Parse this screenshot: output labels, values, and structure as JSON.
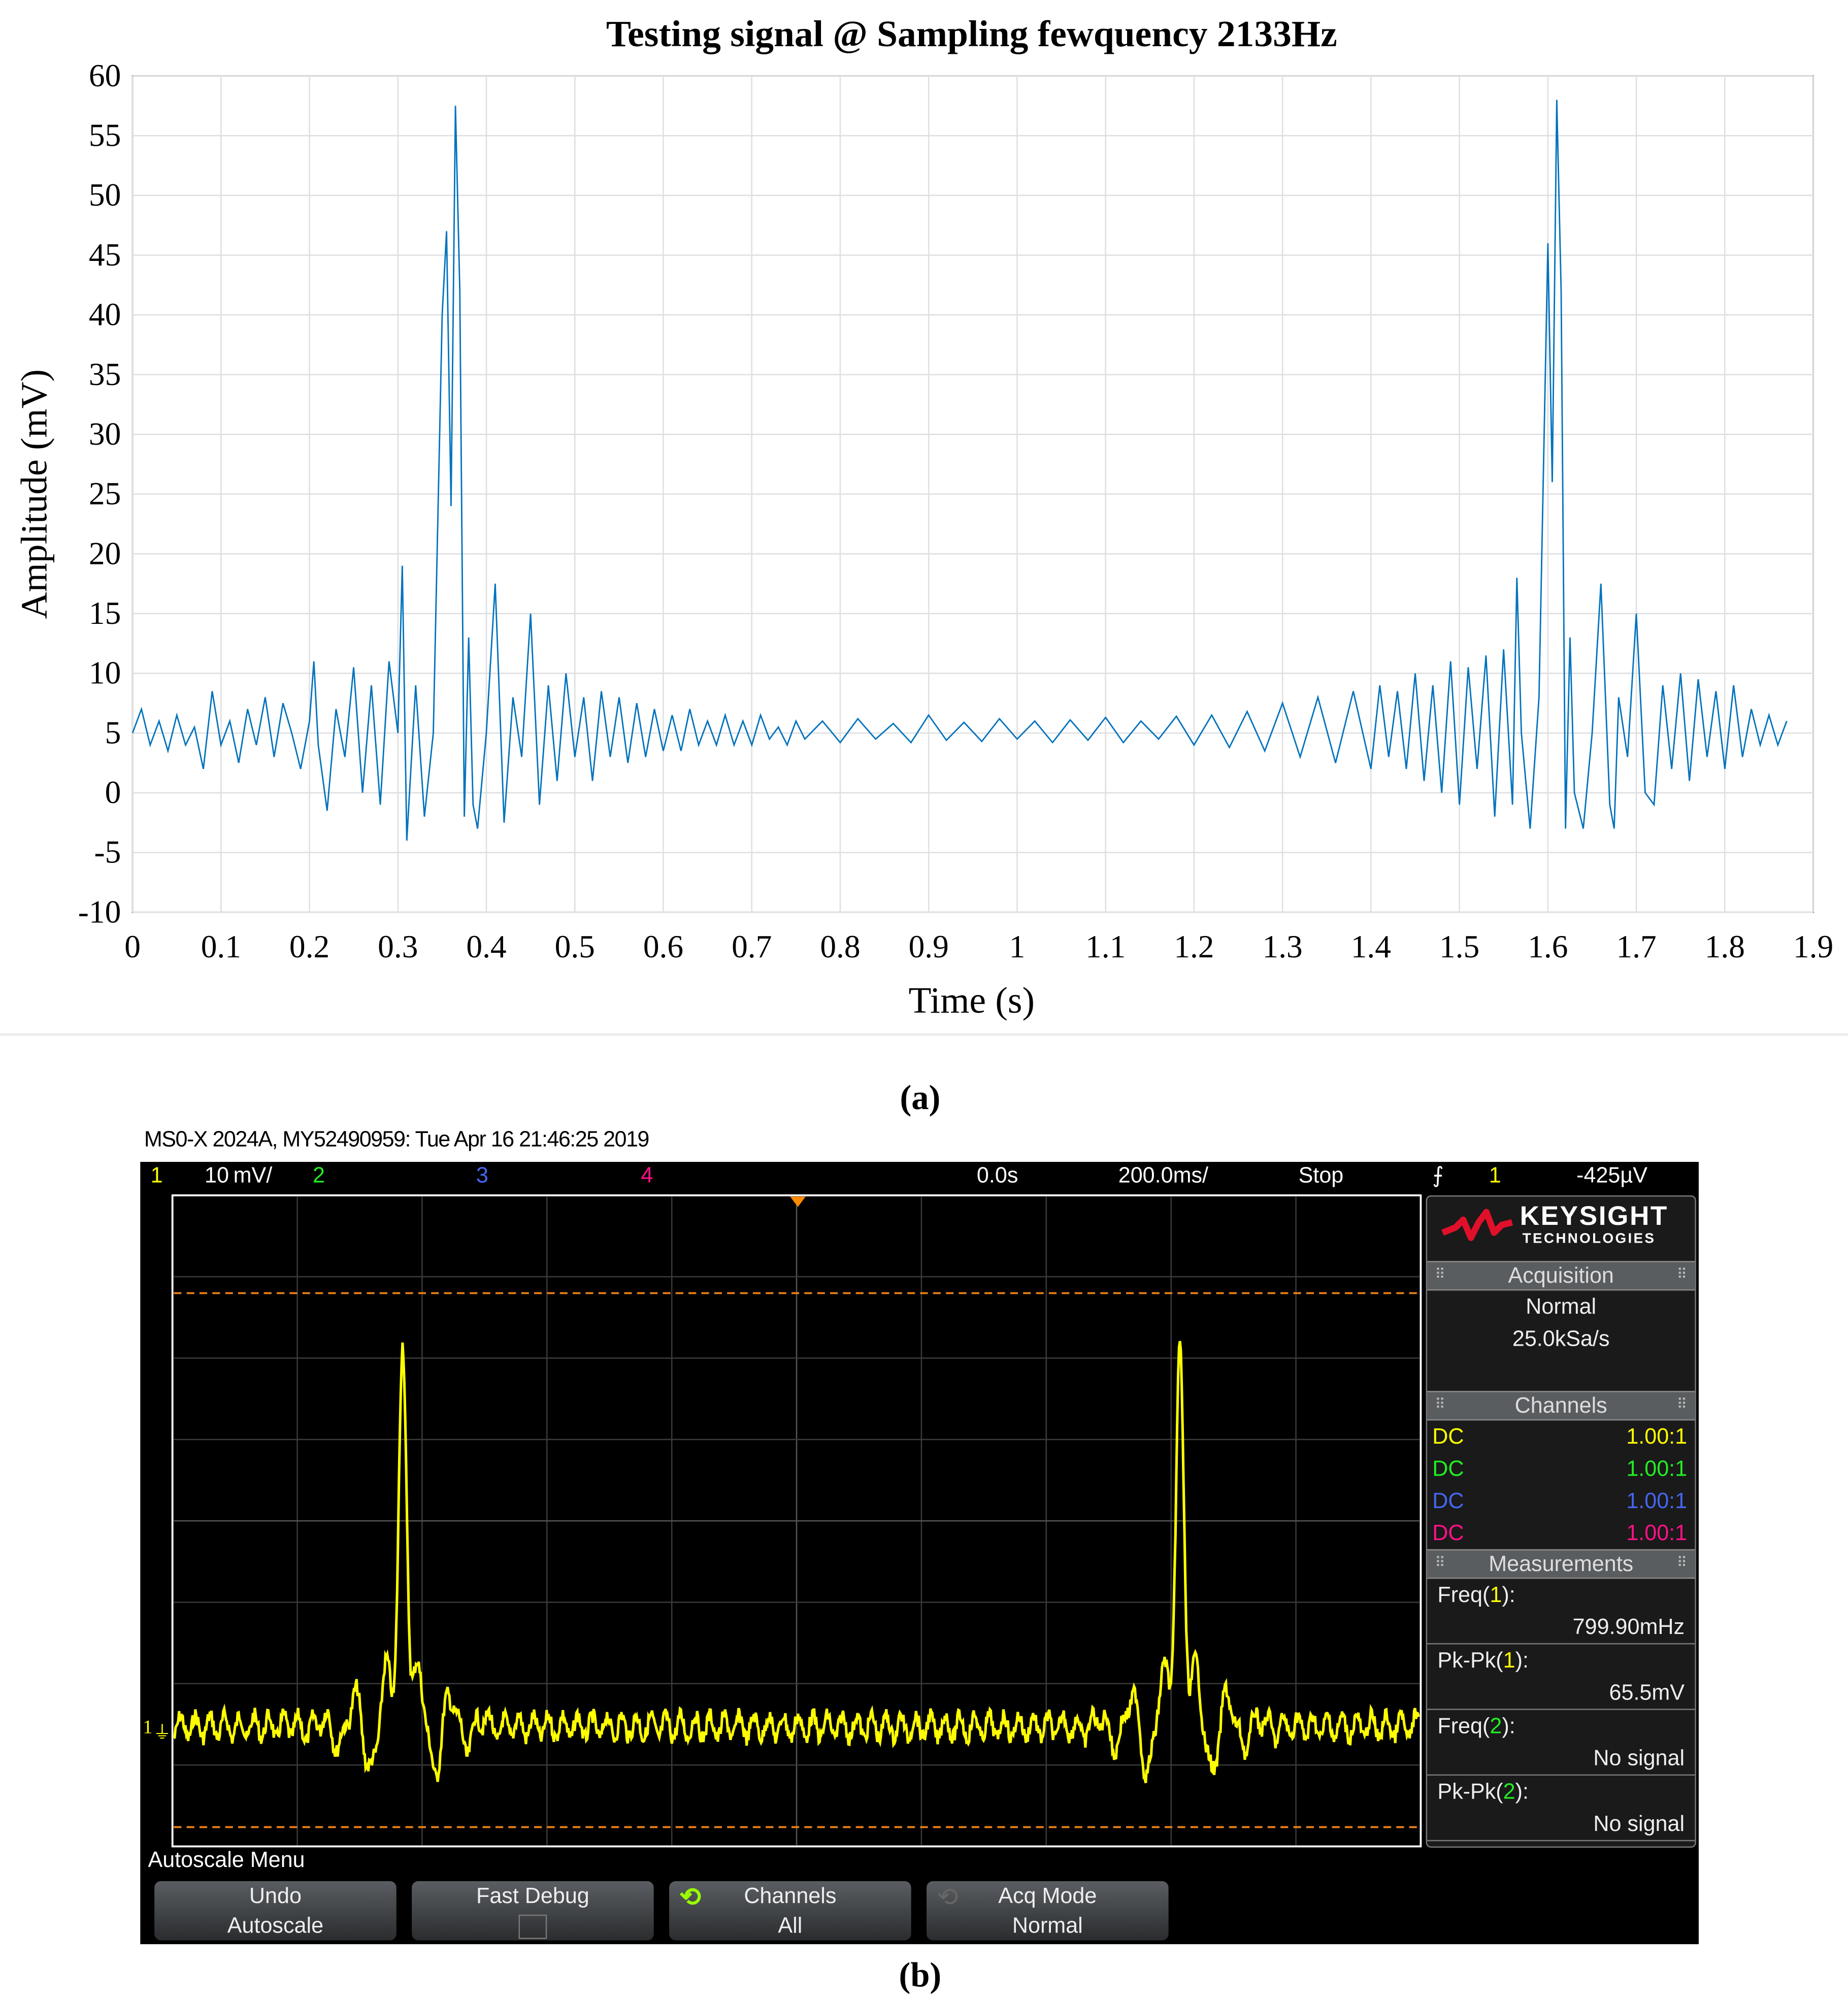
{
  "chart_data": {
    "type": "line",
    "title": "Testing signal @ Sampling fewquency 2133Hz",
    "xlabel": "Time (s)",
    "ylabel": "Amplitude (mV)",
    "xlim": [
      0,
      1.9
    ],
    "ylim": [
      -10,
      60
    ],
    "xticks": [
      0,
      0.1,
      0.2,
      0.3,
      0.4,
      0.5,
      0.6,
      0.7,
      0.8,
      0.9,
      1,
      1.1,
      1.2,
      1.3,
      1.4,
      1.5,
      1.6,
      1.7,
      1.8,
      1.9
    ],
    "yticks": [
      -10,
      -5,
      0,
      5,
      10,
      15,
      20,
      25,
      30,
      35,
      40,
      45,
      50,
      55,
      60
    ],
    "grid": true,
    "series": [
      {
        "name": "signal",
        "color": "#0072BD",
        "points": [
          [
            0,
            5
          ],
          [
            0.01,
            7
          ],
          [
            0.02,
            4
          ],
          [
            0.03,
            6
          ],
          [
            0.04,
            3.5
          ],
          [
            0.05,
            6.5
          ],
          [
            0.06,
            4
          ],
          [
            0.07,
            5.5
          ],
          [
            0.08,
            2
          ],
          [
            0.09,
            8.5
          ],
          [
            0.1,
            4
          ],
          [
            0.11,
            6
          ],
          [
            0.12,
            2.5
          ],
          [
            0.13,
            7
          ],
          [
            0.14,
            4
          ],
          [
            0.15,
            8
          ],
          [
            0.16,
            3
          ],
          [
            0.17,
            7.5
          ],
          [
            0.18,
            5
          ],
          [
            0.19,
            2
          ],
          [
            0.2,
            6
          ],
          [
            0.205,
            11
          ],
          [
            0.21,
            4
          ],
          [
            0.22,
            -1.5
          ],
          [
            0.23,
            7
          ],
          [
            0.24,
            3
          ],
          [
            0.25,
            10.5
          ],
          [
            0.26,
            0
          ],
          [
            0.27,
            9
          ],
          [
            0.28,
            -1
          ],
          [
            0.29,
            11
          ],
          [
            0.3,
            5
          ],
          [
            0.305,
            19
          ],
          [
            0.31,
            -4
          ],
          [
            0.32,
            9
          ],
          [
            0.33,
            -2
          ],
          [
            0.34,
            5
          ],
          [
            0.35,
            40
          ],
          [
            0.355,
            47
          ],
          [
            0.36,
            24
          ],
          [
            0.365,
            57.5
          ],
          [
            0.37,
            42
          ],
          [
            0.375,
            -2
          ],
          [
            0.38,
            13
          ],
          [
            0.385,
            -1
          ],
          [
            0.39,
            -3
          ],
          [
            0.4,
            5
          ],
          [
            0.41,
            17.5
          ],
          [
            0.42,
            -2.5
          ],
          [
            0.43,
            8
          ],
          [
            0.44,
            3
          ],
          [
            0.45,
            15
          ],
          [
            0.46,
            -1
          ],
          [
            0.47,
            9
          ],
          [
            0.48,
            1
          ],
          [
            0.49,
            10
          ],
          [
            0.5,
            3
          ],
          [
            0.51,
            8
          ],
          [
            0.52,
            1
          ],
          [
            0.53,
            8.5
          ],
          [
            0.54,
            3
          ],
          [
            0.55,
            8
          ],
          [
            0.56,
            2.5
          ],
          [
            0.57,
            7.5
          ],
          [
            0.58,
            3
          ],
          [
            0.59,
            7
          ],
          [
            0.6,
            3.5
          ],
          [
            0.61,
            6.5
          ],
          [
            0.62,
            3.5
          ],
          [
            0.63,
            7
          ],
          [
            0.64,
            4
          ],
          [
            0.65,
            6
          ],
          [
            0.66,
            4
          ],
          [
            0.67,
            6.5
          ],
          [
            0.68,
            4
          ],
          [
            0.69,
            6
          ],
          [
            0.7,
            4
          ],
          [
            0.71,
            6.5
          ],
          [
            0.72,
            4.5
          ],
          [
            0.73,
            5.5
          ],
          [
            0.74,
            4
          ],
          [
            0.75,
            6
          ],
          [
            0.76,
            4.5
          ],
          [
            0.78,
            6
          ],
          [
            0.8,
            4.2
          ],
          [
            0.82,
            6.2
          ],
          [
            0.84,
            4.5
          ],
          [
            0.86,
            5.8
          ],
          [
            0.88,
            4.2
          ],
          [
            0.9,
            6.5
          ],
          [
            0.92,
            4.4
          ],
          [
            0.94,
            5.9
          ],
          [
            0.96,
            4.3
          ],
          [
            0.98,
            6.2
          ],
          [
            1.0,
            4.5
          ],
          [
            1.02,
            6
          ],
          [
            1.04,
            4.2
          ],
          [
            1.06,
            6.1
          ],
          [
            1.08,
            4.4
          ],
          [
            1.1,
            6.3
          ],
          [
            1.12,
            4.2
          ],
          [
            1.14,
            6
          ],
          [
            1.16,
            4.5
          ],
          [
            1.18,
            6.4
          ],
          [
            1.2,
            4
          ],
          [
            1.22,
            6.5
          ],
          [
            1.24,
            3.8
          ],
          [
            1.26,
            6.8
          ],
          [
            1.28,
            3.5
          ],
          [
            1.3,
            7.5
          ],
          [
            1.32,
            3
          ],
          [
            1.34,
            8
          ],
          [
            1.36,
            2.5
          ],
          [
            1.38,
            8.5
          ],
          [
            1.4,
            2
          ],
          [
            1.41,
            9
          ],
          [
            1.42,
            3
          ],
          [
            1.43,
            8.5
          ],
          [
            1.44,
            2
          ],
          [
            1.45,
            10
          ],
          [
            1.46,
            1
          ],
          [
            1.47,
            9
          ],
          [
            1.48,
            0
          ],
          [
            1.49,
            11
          ],
          [
            1.5,
            -1
          ],
          [
            1.51,
            10.5
          ],
          [
            1.52,
            2
          ],
          [
            1.53,
            11.5
          ],
          [
            1.54,
            -2
          ],
          [
            1.55,
            12
          ],
          [
            1.56,
            -1
          ],
          [
            1.565,
            18
          ],
          [
            1.57,
            5
          ],
          [
            1.58,
            -3
          ],
          [
            1.59,
            8
          ],
          [
            1.6,
            46
          ],
          [
            1.605,
            26
          ],
          [
            1.61,
            58
          ],
          [
            1.615,
            42
          ],
          [
            1.62,
            -3
          ],
          [
            1.625,
            13
          ],
          [
            1.63,
            0
          ],
          [
            1.64,
            -3
          ],
          [
            1.65,
            5
          ],
          [
            1.66,
            17.5
          ],
          [
            1.67,
            -1
          ],
          [
            1.675,
            -3
          ],
          [
            1.68,
            8
          ],
          [
            1.69,
            3
          ],
          [
            1.7,
            15
          ],
          [
            1.71,
            0
          ],
          [
            1.72,
            -1
          ],
          [
            1.73,
            9
          ],
          [
            1.74,
            2
          ],
          [
            1.75,
            10
          ],
          [
            1.76,
            1
          ],
          [
            1.77,
            9.5
          ],
          [
            1.78,
            3
          ],
          [
            1.79,
            8.5
          ],
          [
            1.8,
            2
          ],
          [
            1.81,
            9
          ],
          [
            1.82,
            3
          ],
          [
            1.83,
            7
          ],
          [
            1.84,
            4
          ],
          [
            1.85,
            6.5
          ],
          [
            1.86,
            4
          ],
          [
            1.87,
            6
          ]
        ]
      }
    ]
  },
  "captions": {
    "a": "(a)",
    "b": "(b)"
  },
  "scope": {
    "title": "MS0-X 2024A, MY52490959: Tue Apr 16 21:46:25 2019",
    "header": {
      "ch1": "1",
      "ch1_scale": "10 mV/",
      "ch2": "2",
      "ch3": "3",
      "ch4": "4",
      "delay": "0.0s",
      "timebase": "200.0ms/",
      "run_state": "Stop",
      "trigger_icon": "⨍",
      "trigger_ch": "1",
      "trigger_level": "-425µV"
    },
    "channel_marker": "1",
    "peak_times_s": [
      -0.631,
      0.614
    ],
    "timebase_s_per_div": 0.2,
    "volts_per_div_mV": 10,
    "colors": {
      "ch1": "#ffff00",
      "ch2": "#22ee22",
      "ch3": "#4466ee",
      "ch4": "#ff1188",
      "marker": "#ff8c00"
    },
    "brand": {
      "name": "KEYSIGHT",
      "sub": "TECHNOLOGIES"
    },
    "acquisition": {
      "title": "Acquisition",
      "mode": "Normal",
      "rate": "25.0kSa/s"
    },
    "channels": {
      "title": "Channels",
      "rows": [
        {
          "coupling": "DC",
          "probe": "1.00:1"
        },
        {
          "coupling": "DC",
          "probe": "1.00:1"
        },
        {
          "coupling": "DC",
          "probe": "1.00:1"
        },
        {
          "coupling": "DC",
          "probe": "1.00:1"
        }
      ]
    },
    "measurements": {
      "title": "Measurements",
      "items": [
        {
          "label_pre": "Freq(",
          "ch": "1",
          "label_post": "):",
          "value": "799.90mHz"
        },
        {
          "label_pre": "Pk-Pk(",
          "ch": "1",
          "label_post": "):",
          "value": "65.5mV"
        },
        {
          "label_pre": "Freq(",
          "ch": "2",
          "label_post": "):",
          "value": "No signal"
        },
        {
          "label_pre": "Pk-Pk(",
          "ch": "2",
          "label_post": "):",
          "value": "No signal"
        }
      ]
    },
    "menu": {
      "title": "Autoscale Menu",
      "buttons": [
        {
          "line1": "Undo",
          "line2": "Autoscale"
        },
        {
          "line1": "Fast Debug",
          "line2": ""
        },
        {
          "line1": "Channels",
          "line2": "All"
        },
        {
          "line1": "Acq Mode",
          "line2": "Normal"
        }
      ]
    }
  }
}
